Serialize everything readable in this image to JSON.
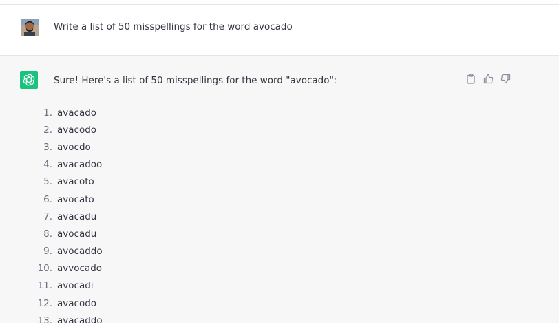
{
  "user_message": {
    "text": "Write a list of 50 misspellings for the word avocado"
  },
  "assistant_message": {
    "intro": "Sure! Here's a list of 50 misspellings for the word \"avocado\":",
    "actions": [
      "clipboard-icon",
      "thumbs-up-icon",
      "thumbs-down-icon"
    ],
    "items": [
      {
        "num": "1.",
        "text": "avacado"
      },
      {
        "num": "2.",
        "text": "avacodo"
      },
      {
        "num": "3.",
        "text": "avocdo"
      },
      {
        "num": "4.",
        "text": "avacadoo"
      },
      {
        "num": "5.",
        "text": "avacoto"
      },
      {
        "num": "6.",
        "text": "avocato"
      },
      {
        "num": "7.",
        "text": "avacadu"
      },
      {
        "num": "8.",
        "text": "avocadu"
      },
      {
        "num": "9.",
        "text": "avocaddo"
      },
      {
        "num": "10.",
        "text": "avvocado"
      },
      {
        "num": "11.",
        "text": "avocadi"
      },
      {
        "num": "12.",
        "text": "avacodo"
      },
      {
        "num": "13.",
        "text": "avacaddo"
      }
    ]
  },
  "colors": {
    "assistant_avatar": "#19c37d",
    "assistant_bg": "#f7f7f8",
    "text": "#343541",
    "number": "#6e6e80"
  }
}
